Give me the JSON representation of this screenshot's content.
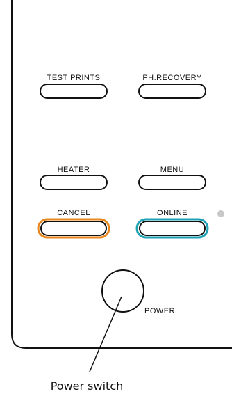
{
  "panel": {
    "buttons": {
      "test_prints": "TEST PRINTS",
      "ph_recovery": "PH.RECOVERY",
      "heater": "HEATER",
      "menu": "MENU",
      "cancel": "CANCEL",
      "online": "ONLINE"
    },
    "power_label": "POWER"
  },
  "callout": {
    "label": "Power switch"
  },
  "colors": {
    "cancel_highlight": "#E8871E",
    "online_highlight": "#1FA1B4",
    "indicator_led": "#C8C8C8",
    "outline": "#111111"
  }
}
